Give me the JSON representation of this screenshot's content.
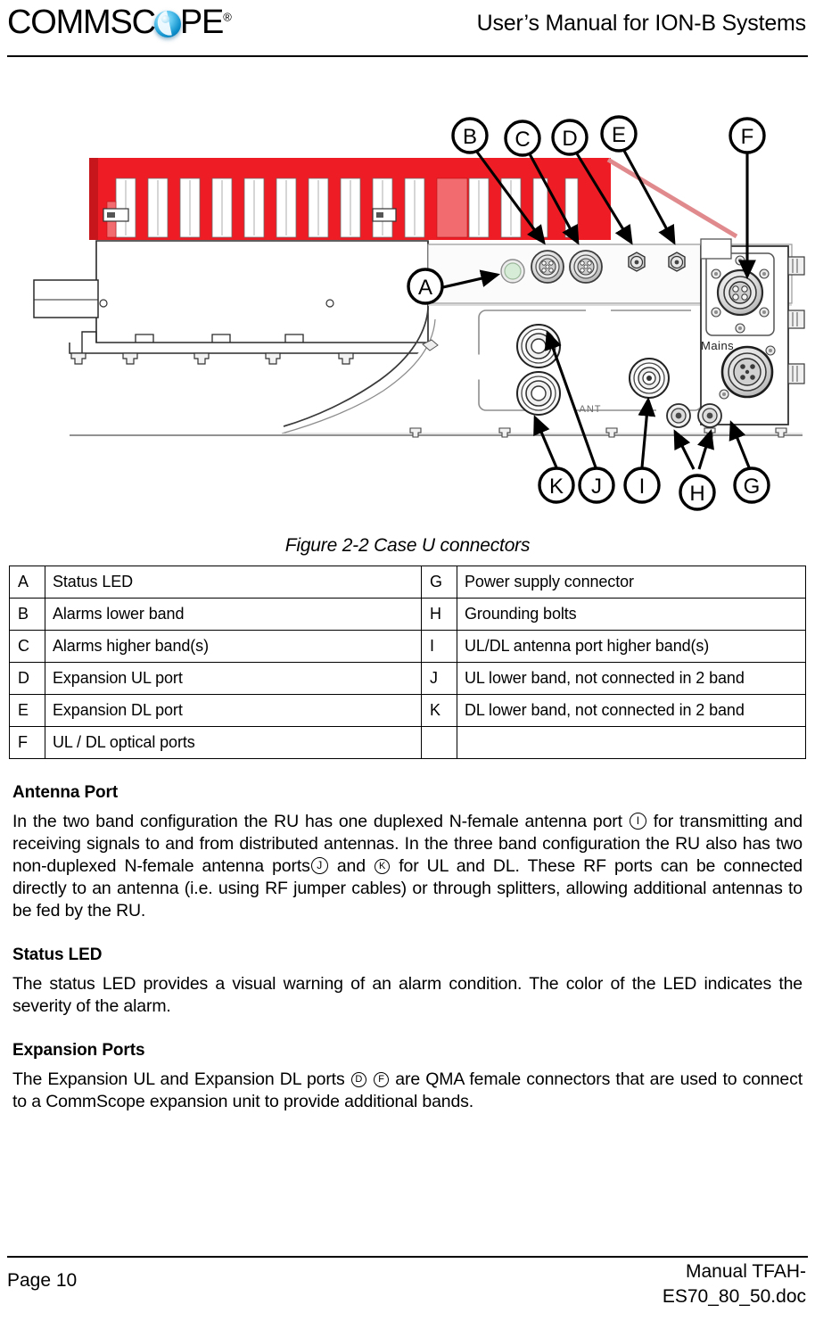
{
  "header": {
    "logo_text_before": "COMMSC",
    "logo_text_after": "PE",
    "logo_registered": "®",
    "logo_icon": "commscope-globe-icon",
    "title": "User’s Manual for ION-B Systems"
  },
  "figure": {
    "caption": "Figure 2-2 Case U connectors",
    "callouts": [
      {
        "id": "A",
        "label": "A"
      },
      {
        "id": "B",
        "label": "B"
      },
      {
        "id": "C",
        "label": "C"
      },
      {
        "id": "D",
        "label": "D"
      },
      {
        "id": "E",
        "label": "E"
      },
      {
        "id": "F",
        "label": "F"
      },
      {
        "id": "G",
        "label": "G"
      },
      {
        "id": "H",
        "label": "H"
      },
      {
        "id": "I",
        "label": "I"
      },
      {
        "id": "J",
        "label": "J"
      },
      {
        "id": "K",
        "label": "K"
      }
    ],
    "device_labels": [
      {
        "id": "mains",
        "text": "Mains"
      },
      {
        "id": "ant",
        "text": "ANT"
      }
    ],
    "colors": {
      "heatsink_red": "#ee1c24",
      "heatsink_red_dark": "#c8161d",
      "body_outline": "#1a1a1a",
      "body_fill": "#ffffff",
      "metal_grey": "#d9d9d9",
      "led_green": "#d7ecd7"
    }
  },
  "table": {
    "rows": [
      {
        "key": "A",
        "value": "Status LED",
        "key2": "G",
        "value2": "Power supply connector"
      },
      {
        "key": "B",
        "value": "Alarms lower band",
        "key2": "H",
        "value2": "Grounding bolts"
      },
      {
        "key": "C",
        "value": "Alarms higher band(s)",
        "key2": "I",
        "value2": "UL/DL antenna port higher band(s)"
      },
      {
        "key": "D",
        "value": "Expansion UL port",
        "key2": "J",
        "value2": "UL lower band, not connected in 2 band"
      },
      {
        "key": "E",
        "value": "Expansion DL port",
        "key2": "K",
        "value2": "DL lower band, not connected in 2 band"
      },
      {
        "key": "F",
        "value": "UL / DL optical ports",
        "key2": "",
        "value2": ""
      }
    ]
  },
  "sections": {
    "antenna_port": {
      "heading": "Antenna Port",
      "text_1": "In the two band configuration the RU has one duplexed N-female antenna port",
      "ref_1": "I",
      "text_2": "for transmitting and receiving signals to and from distributed antennas. In the three band configuration the RU also has two non-duplexed N-female antenna ports",
      "ref_2": "J",
      "text_3": "and",
      "ref_3": "K",
      "text_4": "for UL and DL. These RF ports can be connected directly to an antenna (i.e. using RF jumper cables) or through splitters, allowing additional antennas to be fed by the RU."
    },
    "status_led": {
      "heading": "Status LED",
      "text": "The status LED provides a visual warning of an alarm condition. The color of the LED indicates the severity of the alarm."
    },
    "expansion_ports": {
      "heading": "Expansion Ports",
      "text_1": "The Expansion UL and Expansion DL ports",
      "ref_1": "D",
      "ref_2": "F",
      "text_2": "are QMA female connectors that are used to connect to a CommScope expansion unit to provide additional bands."
    }
  },
  "footer": {
    "page": "Page 10",
    "doc_line1": "Manual TFAH-",
    "doc_line2": "ES70_80_50.doc"
  }
}
